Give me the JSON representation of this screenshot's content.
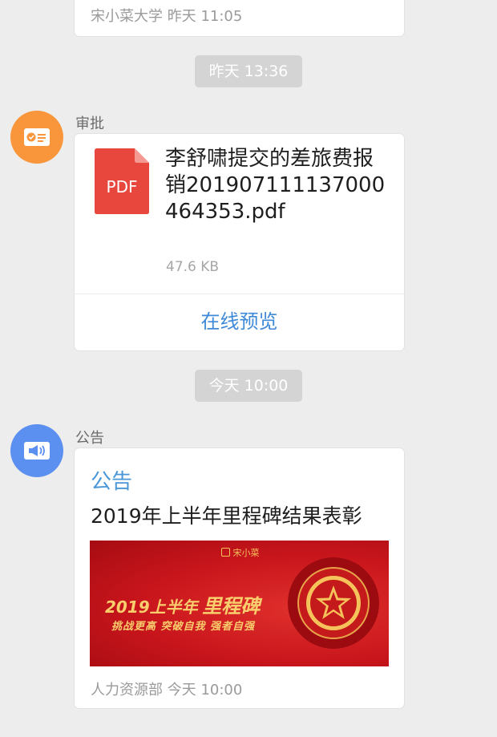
{
  "colors": {
    "page_bg": "#ededed",
    "approval_avatar": "#f9963b",
    "notice_avatar": "#5b8ff0",
    "pdf_red": "#e8473e",
    "link_blue": "#3f8ad8",
    "banner_red": "#c8151c",
    "banner_gold": "#f9ce6c"
  },
  "previous_message": {
    "meta": "宋小菜大学   昨天 11:05"
  },
  "timestamps": [
    "昨天 13:36",
    "今天 10:00"
  ],
  "approval_message": {
    "avatar_icon": "approval-id-card-icon",
    "sender": "审批",
    "file": {
      "icon": "pdf-file-icon",
      "type_label": "PDF",
      "name": "李舒啸提交的差旅费报销201907111137000464353.pdf",
      "size": "47.6 KB"
    },
    "action_label": "在线预览"
  },
  "notice_message": {
    "avatar_icon": "megaphone-icon",
    "sender": "公告",
    "tag": "公告",
    "title": "2019年上半年里程碑结果表彰",
    "banner": {
      "logo_text": "宋小菜",
      "year_text": "2019上半年",
      "milestone_text": "里程碑",
      "slogan": "挑战更高   突破自我   强者自强",
      "medal_icon": "star-medal-icon"
    },
    "meta": "人力资源部   今天 10:00"
  }
}
